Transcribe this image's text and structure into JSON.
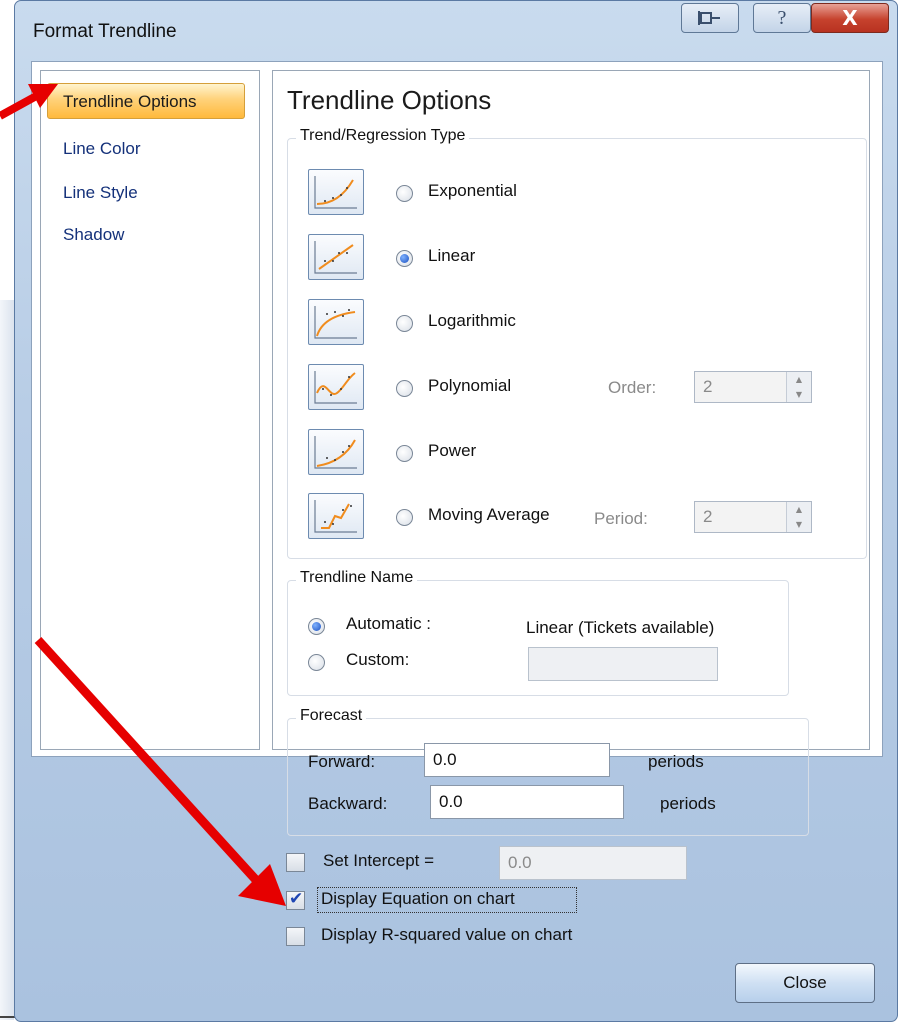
{
  "window": {
    "title": "Format Trendline"
  },
  "nav": {
    "items": [
      {
        "label": "Trendline Options"
      },
      {
        "label": "Line Color"
      },
      {
        "label": "Line Style"
      },
      {
        "label": "Shadow"
      }
    ]
  },
  "panel": {
    "title": "Trendline Options",
    "trend_group": {
      "label": "Trend/Regression Type",
      "options": [
        {
          "label": "Exponential",
          "selected": false
        },
        {
          "label": "Linear",
          "selected": true
        },
        {
          "label": "Logarithmic",
          "selected": false
        },
        {
          "label": "Polynomial",
          "selected": false
        },
        {
          "label": "Power",
          "selected": false
        },
        {
          "label": "Moving Average",
          "selected": false
        }
      ],
      "order": {
        "label": "Order:",
        "value": "2"
      },
      "period": {
        "label": "Period:",
        "value": "2"
      }
    },
    "name_group": {
      "label": "Trendline Name",
      "automatic_label": "Automatic :",
      "automatic_value": "Linear (Tickets available)",
      "custom_label": "Custom:",
      "custom_value": ""
    },
    "forecast_group": {
      "label": "Forecast",
      "forward_label": "Forward:",
      "forward_value": "0.0",
      "forward_unit": "periods",
      "backward_label": "Backward:",
      "backward_value": "0.0",
      "backward_unit": "periods"
    },
    "set_intercept": {
      "label": "Set Intercept =",
      "value": "0.0",
      "checked": false
    },
    "display_equation": {
      "label": "Display Equation on chart",
      "checked": true
    },
    "display_rsquared": {
      "label": "Display R-squared value on chart",
      "checked": false
    }
  },
  "buttons": {
    "close_label": "Close"
  },
  "colors": {
    "arrow": "#e60000",
    "nav_active": "#ffc85a",
    "link_text": "#14317a"
  }
}
